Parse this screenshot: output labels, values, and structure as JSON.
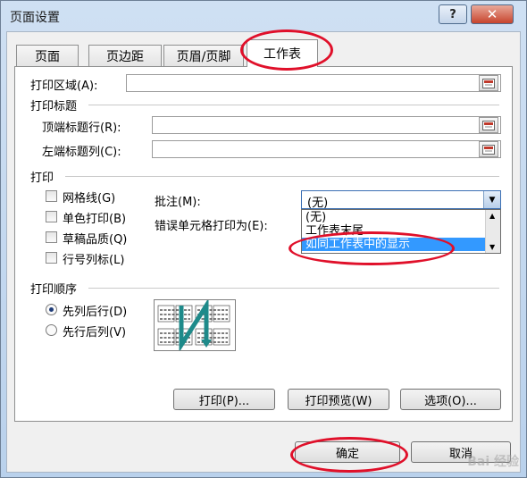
{
  "window": {
    "title": "页面设置",
    "help_label": "?",
    "close_label": "✕"
  },
  "tabs": [
    {
      "label": "页面"
    },
    {
      "label": "页边距"
    },
    {
      "label": "页眉/页脚"
    },
    {
      "label": "工作表"
    }
  ],
  "print_area": {
    "label": "打印区域(A):",
    "value": ""
  },
  "print_titles": {
    "section_label": "打印标题",
    "rows_label": "顶端标题行(R):",
    "rows_value": "",
    "cols_label": "左端标题列(C):",
    "cols_value": ""
  },
  "print": {
    "section_label": "打印",
    "gridlines": "网格线(G)",
    "black_white": "单色打印(B)",
    "draft": "草稿品质(Q)",
    "headings": "行号列标(L)",
    "comments_label": "批注(M):",
    "comments_value": "(无)",
    "errors_label": "错误单元格打印为(E):",
    "dropdown_options": [
      "(无)",
      "工作表末尾",
      "如同工作表中的显示"
    ]
  },
  "page_order": {
    "section_label": "打印顺序",
    "down_then_over": "先列后行(D)",
    "over_then_down": "先行后列(V)"
  },
  "buttons": {
    "print": "打印(P)...",
    "preview": "打印预览(W)",
    "options": "选项(O)...",
    "ok": "确定",
    "cancel": "取消"
  },
  "watermark": "Bai 经验",
  "colors": {
    "highlight": "#3399ff",
    "annotation": "#e0102a",
    "order_arrow": "#1e8a8a"
  }
}
